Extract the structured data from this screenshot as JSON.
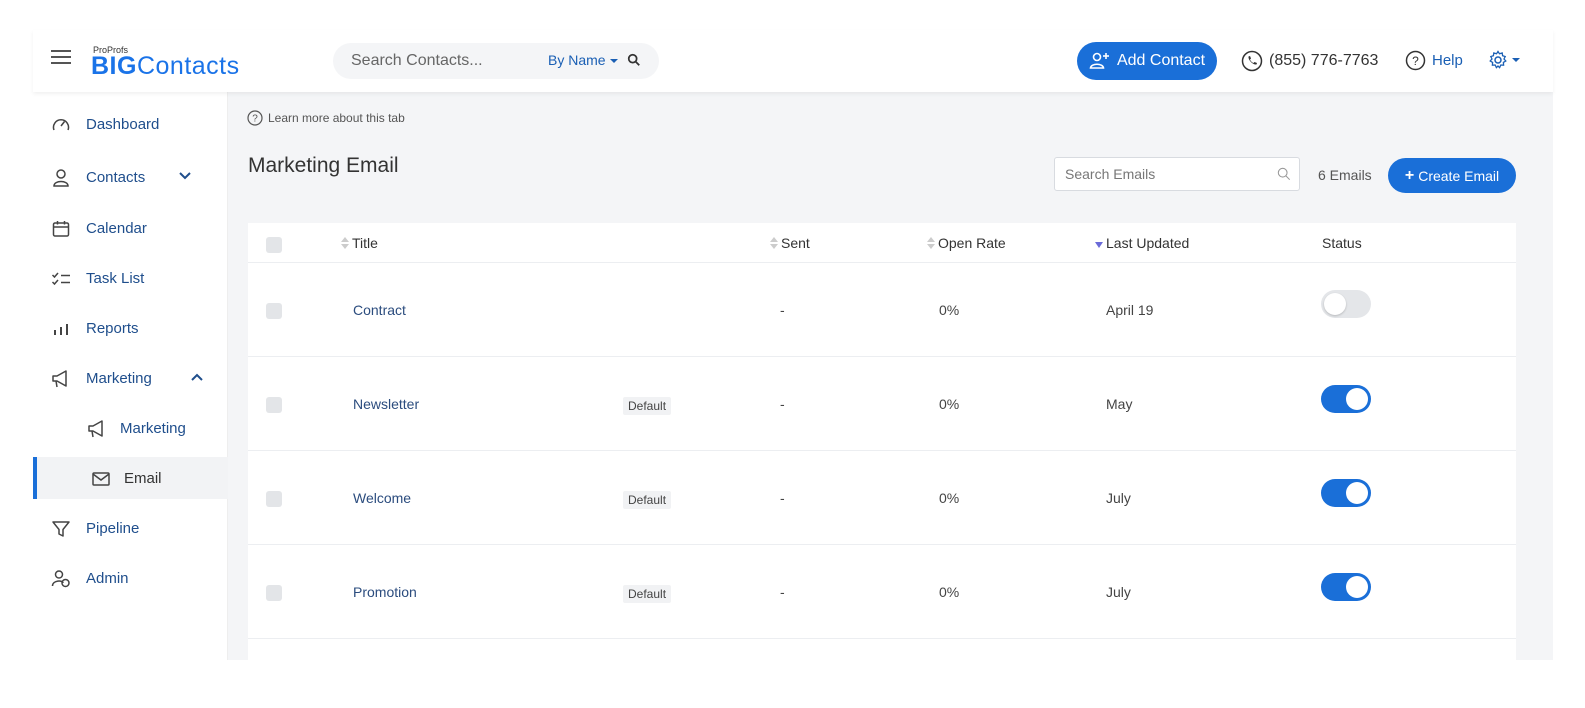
{
  "header": {
    "logo_small": "ProProfs",
    "logo_big_bold": "BIG",
    "logo_big_light": "Contacts",
    "search_placeholder": "Search Contacts...",
    "search_mode": "By Name",
    "add_contact_label": "Add Contact",
    "phone": "(855) 776-7763",
    "help_label": "Help"
  },
  "sidebar": {
    "items": [
      {
        "label": "Dashboard",
        "icon": "gauge-icon"
      },
      {
        "label": "Contacts",
        "icon": "person-icon"
      },
      {
        "label": "Calendar",
        "icon": "calendar-icon"
      },
      {
        "label": "Task List",
        "icon": "checklist-icon"
      },
      {
        "label": "Reports",
        "icon": "bar-chart-icon"
      },
      {
        "label": "Marketing",
        "icon": "megaphone-icon"
      },
      {
        "label": "Marketing",
        "icon": "megaphone-icon"
      },
      {
        "label": "Email",
        "icon": "envelope-icon"
      },
      {
        "label": "Pipeline",
        "icon": "funnel-icon"
      },
      {
        "label": "Admin",
        "icon": "users-icon"
      }
    ]
  },
  "main": {
    "learn_more": "Learn more about this tab",
    "title": "Marketing Email",
    "search_placeholder": "Search Emails",
    "count": "6 Emails",
    "create_label": "Create Email",
    "columns": {
      "title": "Title",
      "sent": "Sent",
      "open_rate": "Open Rate",
      "last_updated": "Last Updated",
      "status": "Status"
    },
    "rows": [
      {
        "title": "Contract",
        "badge": "",
        "sent": "-",
        "open_rate": "0%",
        "last_updated": "April 19",
        "status": "off"
      },
      {
        "title": "Newsletter",
        "badge": "Default",
        "sent": "-",
        "open_rate": "0%",
        "last_updated": "May",
        "status": "on"
      },
      {
        "title": "Welcome",
        "badge": "Default",
        "sent": "-",
        "open_rate": "0%",
        "last_updated": "July",
        "status": "on"
      },
      {
        "title": "Promotion",
        "badge": "Default",
        "sent": "-",
        "open_rate": "0%",
        "last_updated": "July",
        "status": "on"
      }
    ]
  },
  "colors": {
    "accent": "#1a6fd8",
    "nav_text": "#1f4e8c",
    "background": "#f4f5f7"
  }
}
